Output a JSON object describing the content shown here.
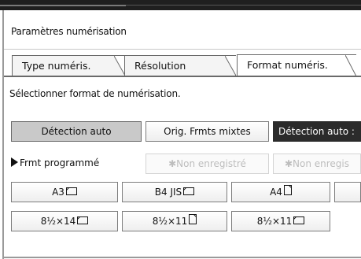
{
  "window": {
    "title": "Paramètres numérisation"
  },
  "tabs": [
    {
      "label": "Type numéris.",
      "active": false
    },
    {
      "label": "Résolution",
      "active": false
    },
    {
      "label": "Format numéris.",
      "active": true
    }
  ],
  "instruction": "Sélectionner format de numérisation.",
  "mode_buttons": [
    {
      "label": "Détection auto",
      "state": "selected"
    },
    {
      "label": "Orig. Frmts mixtes",
      "state": "normal"
    },
    {
      "label": "Détection auto :",
      "state": "dark"
    }
  ],
  "programmed": {
    "label": "Frmt programmé",
    "slots": [
      {
        "label": "✱Non enregistré"
      },
      {
        "label": "✱Non enregis"
      }
    ]
  },
  "sizes_row1": [
    {
      "label": "A3",
      "orientation": "landscape"
    },
    {
      "label": "B4 JIS",
      "orientation": "landscape"
    },
    {
      "label": "A4",
      "orientation": "portrait"
    },
    {
      "label": "",
      "orientation": ""
    }
  ],
  "sizes_row2": [
    {
      "label": "8½×14",
      "orientation": "landscape"
    },
    {
      "label": "8½×11",
      "orientation": "portrait"
    },
    {
      "label": "8½×11",
      "orientation": "landscape"
    }
  ]
}
